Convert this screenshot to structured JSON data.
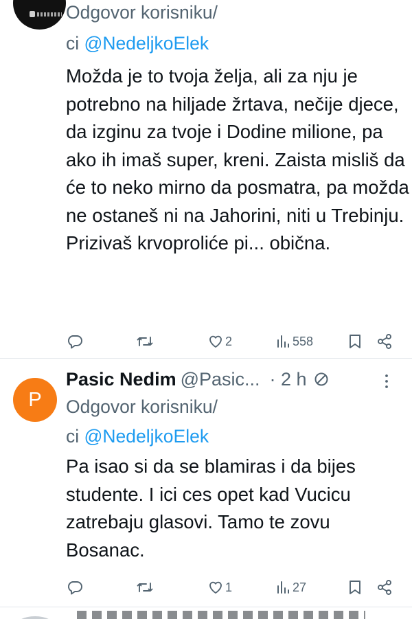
{
  "tweets": [
    {
      "reply_prefix": "Odgovor korisniku/",
      "reply_ci": "ci",
      "reply_handle": "@NedeljkoElek",
      "text": "Možda je to tvoja želja, ali za nju je potrebno na hiljade žrtava, nečije djece, da izginu za tvoje i Dodine milione, pa ako ih imaš super, kreni. Zaista misliš da će to neko mirno da posmatra, pa možda ne ostaneš ni na Jahorini, niti u Trebinju. Prizivaš krvoproliće pi... obična.",
      "actions": {
        "reply_count": "",
        "retweet_count": "",
        "like_count": "2",
        "views_count": "558"
      }
    },
    {
      "avatar_letter": "P",
      "avatar_color": "#f77c15",
      "name": "Pasic Nedim",
      "handle": "@Pasic...",
      "time": "· 2 h",
      "reply_prefix": "Odgovor korisniku/",
      "reply_ci": "ci",
      "reply_handle": "@NedeljkoElek",
      "text": "Pa isao si da se blamiras i da bijes studente. I ici ces opet kad Vucicu zatrebaju glasovi. Tamo te zovu Bosanac.",
      "actions": {
        "reply_count": "",
        "retweet_count": "",
        "like_count": "1",
        "views_count": "27"
      }
    }
  ],
  "colors": {
    "text": "#0f1419",
    "secondary": "#536471",
    "link": "#1d9bf0",
    "divider": "#e1e6ea"
  },
  "icons": [
    "reply-icon",
    "retweet-icon",
    "like-icon",
    "views-icon",
    "bookmark-icon",
    "share-icon",
    "more-icon",
    "no-entry-icon"
  ]
}
